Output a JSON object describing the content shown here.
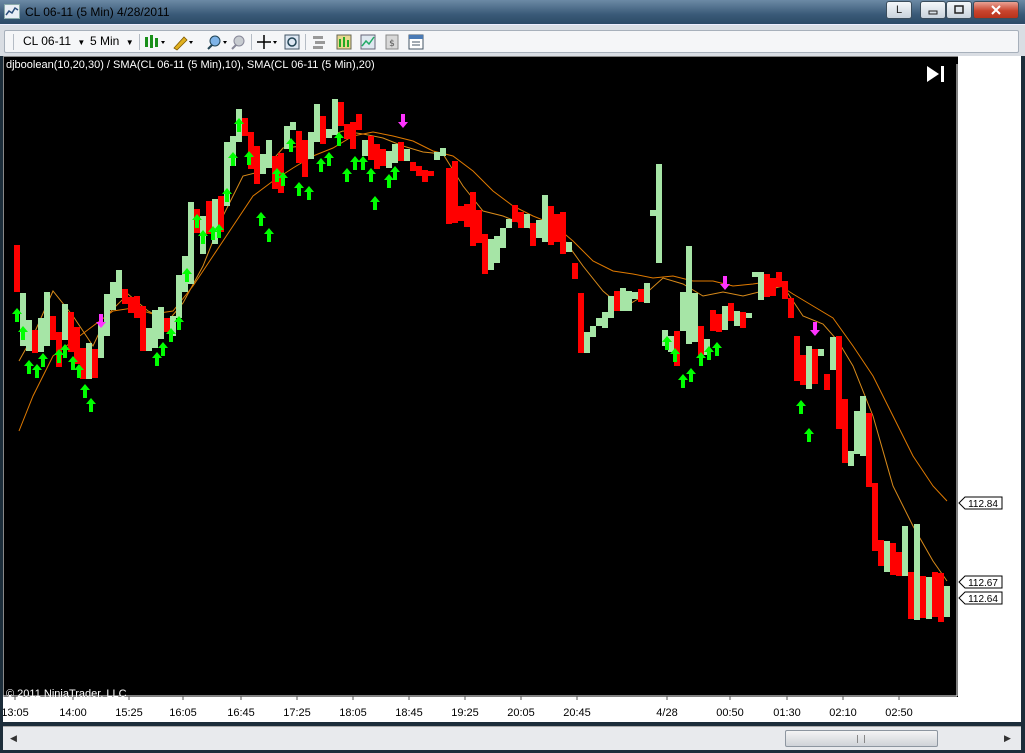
{
  "window": {
    "title": "CL 06-11 (5 Min)  4/28/2011",
    "caption_l": "L",
    "caption_min": "▬",
    "caption_max": "▢",
    "caption_close": "✕"
  },
  "toolbar": {
    "instrument": "CL 06-11",
    "interval": "5 Min"
  },
  "indicator_label": "djboolean(10,20,30) / SMA(CL 06-11 (5 Min),10), SMA(CL 06-11 (5 Min),20)",
  "copyright": "© 2011 NinjaTrader, LLC",
  "colors": {
    "up_bar": "#a6e5a6",
    "down_bar": "#ff0000",
    "up_arrow": "#00ff00",
    "down_arrow": "#ff33ff",
    "sma_fast": "#d98b1a",
    "sma_slow": "#e07a00",
    "background": "#000000",
    "text": "#ffffff"
  },
  "chart_data": {
    "type": "bar",
    "instrument": "CL 06-11",
    "interval": "5 Min",
    "x_tick_labels": [
      "13:05",
      "14:00",
      "15:25",
      "16:05",
      "16:45",
      "17:25",
      "18:05",
      "18:45",
      "19:25",
      "20:05",
      "20:45",
      "4/28",
      "00:50",
      "01:30",
      "02:10",
      "02:50"
    ],
    "price_markers": [
      "112.84",
      "112.67",
      "112.64"
    ],
    "series": [
      {
        "type": "ohlc-bars",
        "up_bars_color": "#a6e5a6",
        "down_bars_color": "#ff0000"
      },
      {
        "type": "line",
        "period": 10
      },
      {
        "type": "line",
        "period": 20
      },
      {
        "type": "signal-arrows"
      }
    ]
  }
}
